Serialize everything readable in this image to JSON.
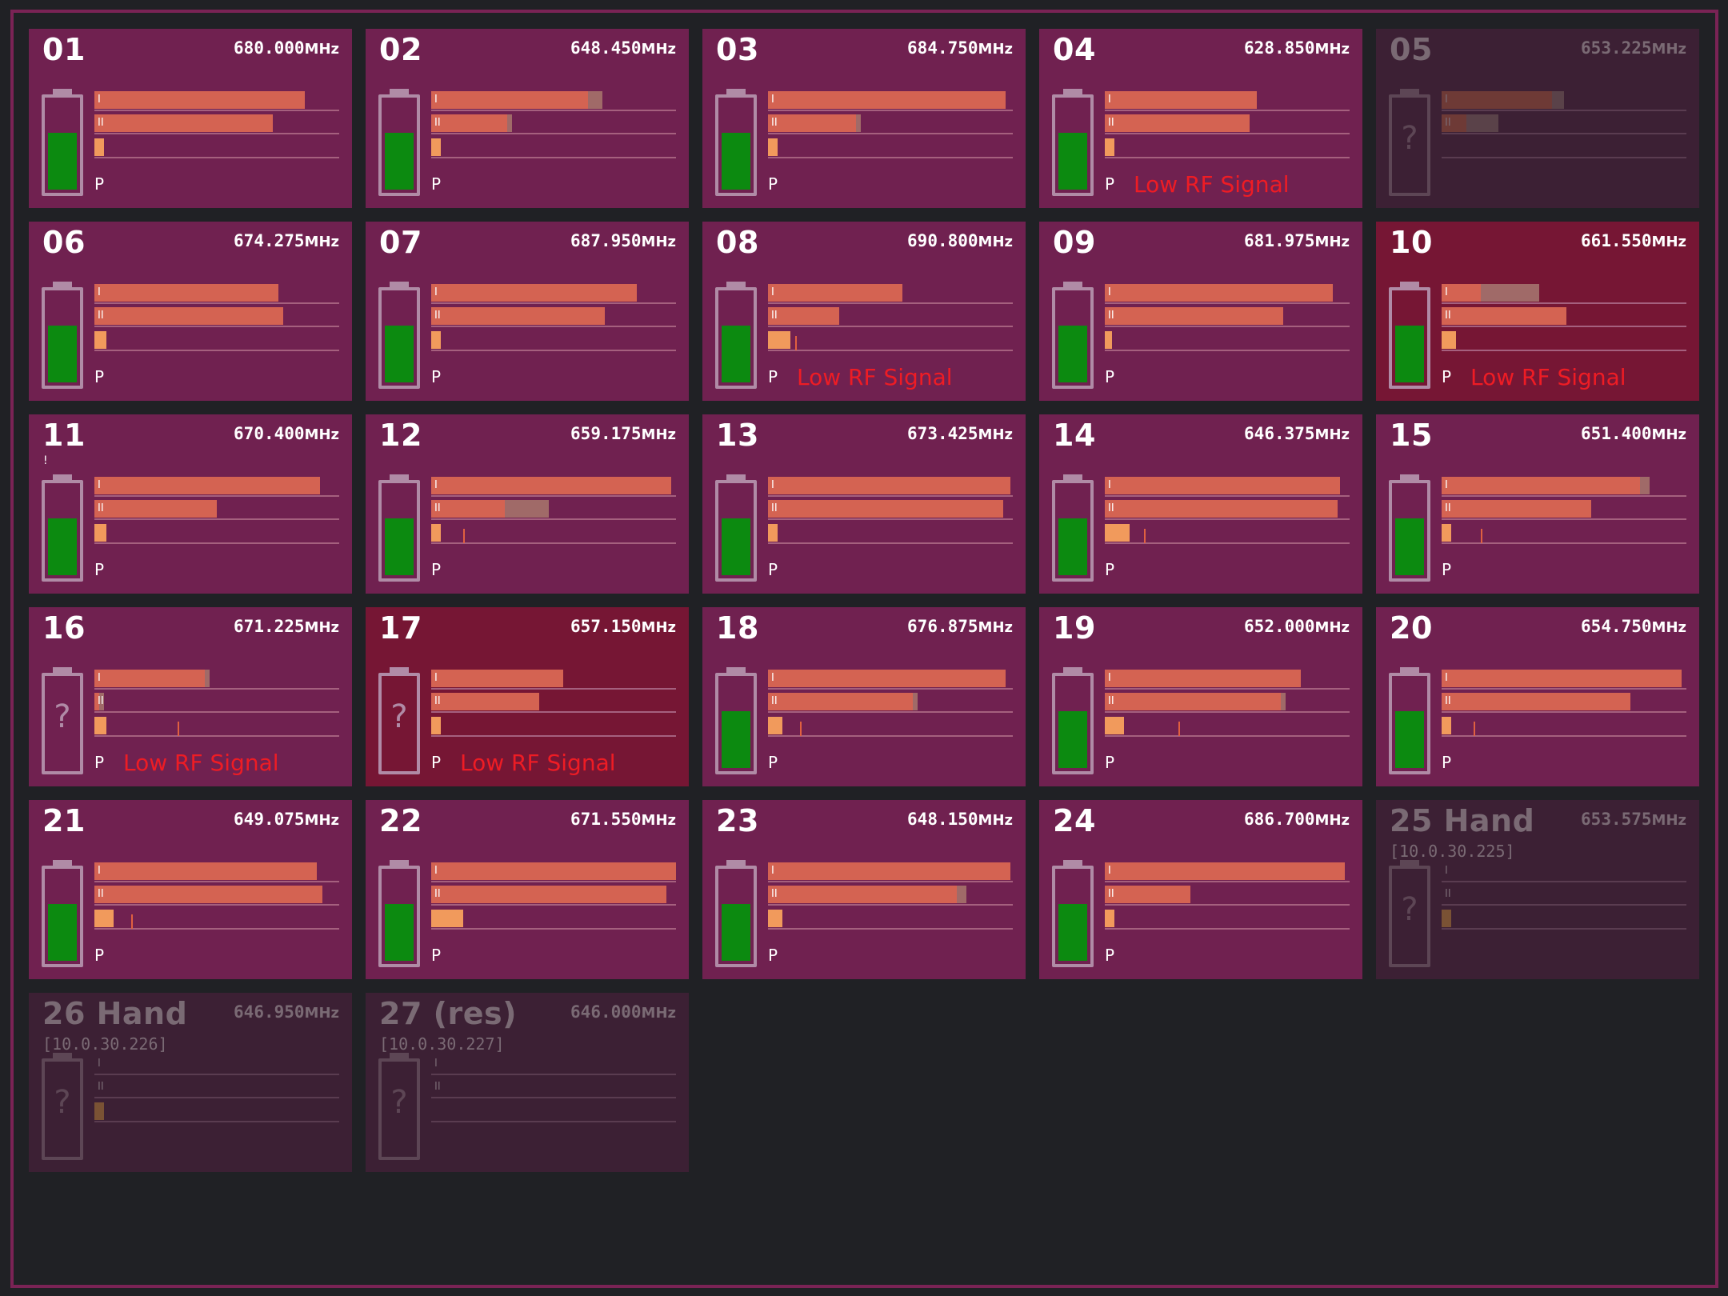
{
  "colors": {
    "background": "#202125",
    "frame": "#7a2355",
    "card_normal": "#702150",
    "card_alert": "#761634",
    "card_offline": "#3c2034",
    "meter_fill": "#d46352",
    "peak_fill": "#f19a5c",
    "battery_fill": "#0c8a10",
    "warning_text": "#ee1c24"
  },
  "unit": "MHz",
  "meter_labels": [
    "I",
    "II"
  ],
  "p_label": "P",
  "channels": [
    {
      "num": "01",
      "freq": "680.000",
      "state": "normal",
      "battery": 0.6,
      "m1": 0.86,
      "m2": 0.73,
      "p": 0.04
    },
    {
      "num": "02",
      "freq": "648.450",
      "state": "normal",
      "battery": 0.6,
      "m1": 0.64,
      "m1ext": 0.7,
      "m2": 0.31,
      "m2ext": 0.33,
      "p": 0.04
    },
    {
      "num": "03",
      "freq": "684.750",
      "state": "normal",
      "battery": 0.6,
      "m1": 0.97,
      "m2": 0.36,
      "m2ext": 0.38,
      "p": 0.04
    },
    {
      "num": "04",
      "freq": "628.850",
      "state": "normal",
      "battery": 0.6,
      "m1": 0.62,
      "m2": 0.59,
      "p": 0.04,
      "warning": "Low RF Signal"
    },
    {
      "num": "05",
      "freq": "653.225",
      "state": "offline",
      "unknown_battery": true,
      "m1": 0.45,
      "m1ext": 0.5,
      "m2": 0.1,
      "m2ext": 0.23,
      "p": 0.0
    },
    {
      "num": "06",
      "freq": "674.275",
      "state": "normal",
      "battery": 0.6,
      "m1": 0.75,
      "m2": 0.77,
      "p": 0.05
    },
    {
      "num": "07",
      "freq": "687.950",
      "state": "normal",
      "battery": 0.6,
      "m1": 0.84,
      "m2": 0.71,
      "p": 0.04
    },
    {
      "num": "08",
      "freq": "690.800",
      "state": "normal",
      "battery": 0.6,
      "m1": 0.55,
      "m2": 0.29,
      "p": 0.09,
      "ptick": 0.11,
      "warning": "Low RF Signal"
    },
    {
      "num": "09",
      "freq": "681.975",
      "state": "normal",
      "battery": 0.6,
      "m1": 0.93,
      "m2": 0.73,
      "p": 0.03
    },
    {
      "num": "10",
      "freq": "661.550",
      "state": "alert",
      "battery": 0.6,
      "m1": 0.16,
      "m1ext": 0.4,
      "m2": 0.51,
      "p": 0.06,
      "warning": "Low RF Signal"
    },
    {
      "num": "11",
      "freq": "670.400",
      "state": "normal",
      "battery": 0.6,
      "m1": 0.92,
      "m2": 0.5,
      "p": 0.05,
      "stray": "!"
    },
    {
      "num": "12",
      "freq": "659.175",
      "state": "normal",
      "battery": 0.6,
      "m1": 0.98,
      "m2": 0.3,
      "m2ext": 0.48,
      "p": 0.04,
      "ptick": 0.13
    },
    {
      "num": "13",
      "freq": "673.425",
      "state": "normal",
      "battery": 0.6,
      "m1": 0.99,
      "m2": 0.96,
      "p": 0.04
    },
    {
      "num": "14",
      "freq": "646.375",
      "state": "normal",
      "battery": 0.6,
      "m1": 0.96,
      "m2": 0.95,
      "p": 0.1,
      "ptick": 0.16
    },
    {
      "num": "15",
      "freq": "651.400",
      "state": "normal",
      "battery": 0.6,
      "m1": 0.81,
      "m1ext": 0.85,
      "m2": 0.61,
      "p": 0.04,
      "ptick": 0.16
    },
    {
      "num": "16",
      "freq": "671.225",
      "state": "normal",
      "unknown_battery": true,
      "m1": 0.45,
      "m1ext": 0.47,
      "m2": 0.02,
      "m2ext": 0.04,
      "p": 0.05,
      "ptick": 0.34,
      "warning": "Low RF Signal"
    },
    {
      "num": "17",
      "freq": "657.150",
      "state": "alert",
      "unknown_battery": true,
      "m1": 0.54,
      "m2": 0.44,
      "p": 0.04,
      "warning": "Low RF Signal"
    },
    {
      "num": "18",
      "freq": "676.875",
      "state": "normal",
      "battery": 0.6,
      "m1": 0.97,
      "m2": 0.59,
      "m2ext": 0.61,
      "p": 0.06,
      "ptick": 0.13
    },
    {
      "num": "19",
      "freq": "652.000",
      "state": "normal",
      "battery": 0.6,
      "m1": 0.8,
      "m2": 0.72,
      "m2ext": 0.74,
      "p": 0.08,
      "ptick": 0.3
    },
    {
      "num": "20",
      "freq": "654.750",
      "state": "normal",
      "battery": 0.6,
      "m1": 0.98,
      "m2": 0.77,
      "p": 0.04,
      "ptick": 0.13
    },
    {
      "num": "21",
      "freq": "649.075",
      "state": "normal",
      "battery": 0.6,
      "m1": 0.91,
      "m2": 0.93,
      "p": 0.08,
      "ptick": 0.15
    },
    {
      "num": "22",
      "freq": "671.550",
      "state": "normal",
      "battery": 0.6,
      "m1": 1.0,
      "m2": 0.96,
      "p": 0.13
    },
    {
      "num": "23",
      "freq": "648.150",
      "state": "normal",
      "battery": 0.6,
      "m1": 0.99,
      "m2": 0.77,
      "m2ext": 0.81,
      "p": 0.06
    },
    {
      "num": "24",
      "freq": "686.700",
      "state": "normal",
      "battery": 0.6,
      "m1": 0.98,
      "m2": 0.35,
      "p": 0.04
    },
    {
      "num": "25 Hand",
      "freq": "653.575",
      "state": "offline",
      "ip": "[10.0.30.225]",
      "unknown_battery": true,
      "m1": 0.0,
      "m2": 0.0,
      "p": 0.04
    },
    {
      "num": "26 Hand",
      "freq": "646.950",
      "state": "offline",
      "ip": "[10.0.30.226]",
      "unknown_battery": true,
      "m1": 0.0,
      "m2": 0.0,
      "p": 0.04
    },
    {
      "num": "27 (res)",
      "freq": "646.000",
      "state": "offline",
      "ip": "[10.0.30.227]",
      "unknown_battery": true,
      "m1": 0.0,
      "m2": 0.0,
      "p": 0.0
    }
  ]
}
